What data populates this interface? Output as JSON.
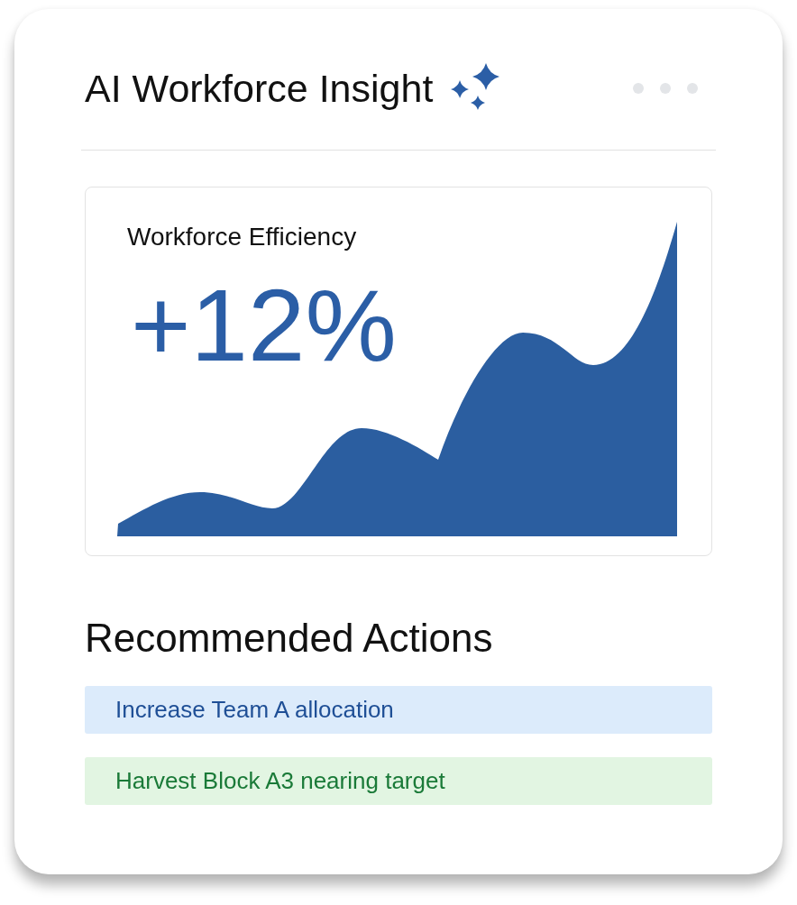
{
  "card": {
    "title": "AI Workforce Insight"
  },
  "efficiency_panel": {
    "label": "Workforce Efficiency",
    "value": "+12%"
  },
  "recommended_actions": {
    "heading": "Recommended Actions",
    "items": [
      {
        "kind": "info",
        "text": "Increase Team A allocation"
      },
      {
        "kind": "success",
        "text": "Harvest Block A3 nearing target"
      }
    ]
  }
}
